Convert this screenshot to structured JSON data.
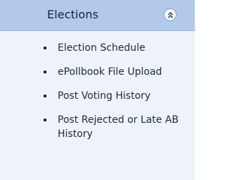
{
  "panel": {
    "title": "Elections",
    "collapse_icon": "double-chevron-up-icon",
    "items": [
      {
        "label": "Election Schedule"
      },
      {
        "label": "ePollbook File Upload"
      },
      {
        "label": "Post Voting History"
      },
      {
        "label": "Post Rejected or Late AB History"
      }
    ]
  },
  "colors": {
    "header_bg": "#b3c9ea",
    "panel_bg": "#eef3fa",
    "text": "#202a3d"
  }
}
